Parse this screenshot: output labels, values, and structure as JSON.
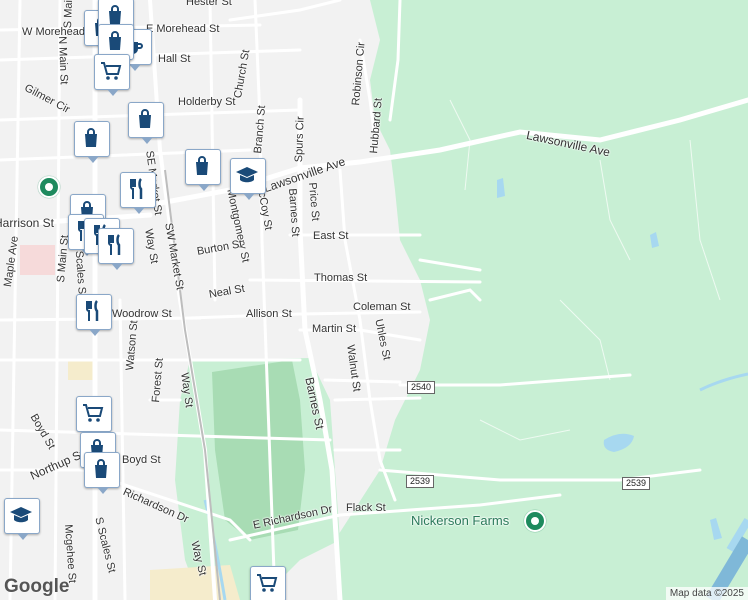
{
  "streets": [
    {
      "name": "Hester St"
    },
    {
      "name": "W Morehead St"
    },
    {
      "name": "E Morehead St"
    },
    {
      "name": "Hall St"
    },
    {
      "name": "Gilmer Cir"
    },
    {
      "name": "Church St"
    },
    {
      "name": "Holderby St"
    },
    {
      "name": "Robinson Cir"
    },
    {
      "name": "Hubbard St"
    },
    {
      "name": "Branch St"
    },
    {
      "name": "Spurs Cir"
    },
    {
      "name": "Lawsonville Ave"
    },
    {
      "name": "Lawsonville Ave"
    },
    {
      "name": "McCoy St"
    },
    {
      "name": "Price St"
    },
    {
      "name": "Montgomery St"
    },
    {
      "name": "Barnes St"
    },
    {
      "name": "SE Market St"
    },
    {
      "name": "SW Market St"
    },
    {
      "name": "Way St"
    },
    {
      "name": "Harrison St"
    },
    {
      "name": "East St"
    },
    {
      "name": "Burton St"
    },
    {
      "name": "Maple Ave"
    },
    {
      "name": "S Main St"
    },
    {
      "name": "S Scales St"
    },
    {
      "name": "Thomas St"
    },
    {
      "name": "Neal St"
    },
    {
      "name": "Coleman St"
    },
    {
      "name": "Woodrow St"
    },
    {
      "name": "Allison St"
    },
    {
      "name": "Uhles St"
    },
    {
      "name": "Martin St"
    },
    {
      "name": "Walnut St"
    },
    {
      "name": "Barnes St"
    },
    {
      "name": "Watson St"
    },
    {
      "name": "Way St"
    },
    {
      "name": "Forest St"
    },
    {
      "name": "Boyd St"
    },
    {
      "name": "Boyd St"
    },
    {
      "name": "Northup St"
    },
    {
      "name": "Richardson Dr"
    },
    {
      "name": "E Richardson Dr"
    },
    {
      "name": "Flack St"
    },
    {
      "name": "S Scales St"
    },
    {
      "name": "Mcgehee St"
    },
    {
      "name": "Way St"
    },
    {
      "name": "S Main St"
    },
    {
      "name": "N Main St"
    },
    {
      "name": "ville"
    }
  ],
  "route_shields": [
    "2540",
    "2539",
    "2539"
  ],
  "places": [
    {
      "name": "Nickerson Farms",
      "icon": "park-pin-icon"
    }
  ],
  "markers": [
    {
      "icon": "shopping-bag-icon"
    },
    {
      "icon": "shopping-bag-icon"
    },
    {
      "icon": "coffee-cup-icon"
    },
    {
      "icon": "shopping-cart-icon"
    },
    {
      "icon": "shopping-bag-icon"
    },
    {
      "icon": "shopping-bag-icon"
    },
    {
      "icon": "shopping-bag-icon"
    },
    {
      "icon": "school-icon"
    },
    {
      "icon": "restaurant-icon"
    },
    {
      "icon": "shopping-bag-icon"
    },
    {
      "icon": "restaurant-icon"
    },
    {
      "icon": "restaurant-icon"
    },
    {
      "icon": "restaurant-icon"
    },
    {
      "icon": "shopping-cart-icon"
    },
    {
      "icon": "shopping-bag-icon"
    },
    {
      "icon": "shopping-bag-icon"
    },
    {
      "icon": "school-icon"
    },
    {
      "icon": "shopping-cart-icon"
    },
    {
      "icon": "shopping-bag-icon"
    }
  ],
  "colors": {
    "park": "#c8efd4",
    "golf": "#a8dcb4",
    "water": "#a7d8f0",
    "road": "#ffffff",
    "marker_icon": "#1a4a78",
    "poi_text": "#2a7a5a"
  },
  "branding": {
    "logo": "Google",
    "attribution": "Map data ©2025"
  }
}
